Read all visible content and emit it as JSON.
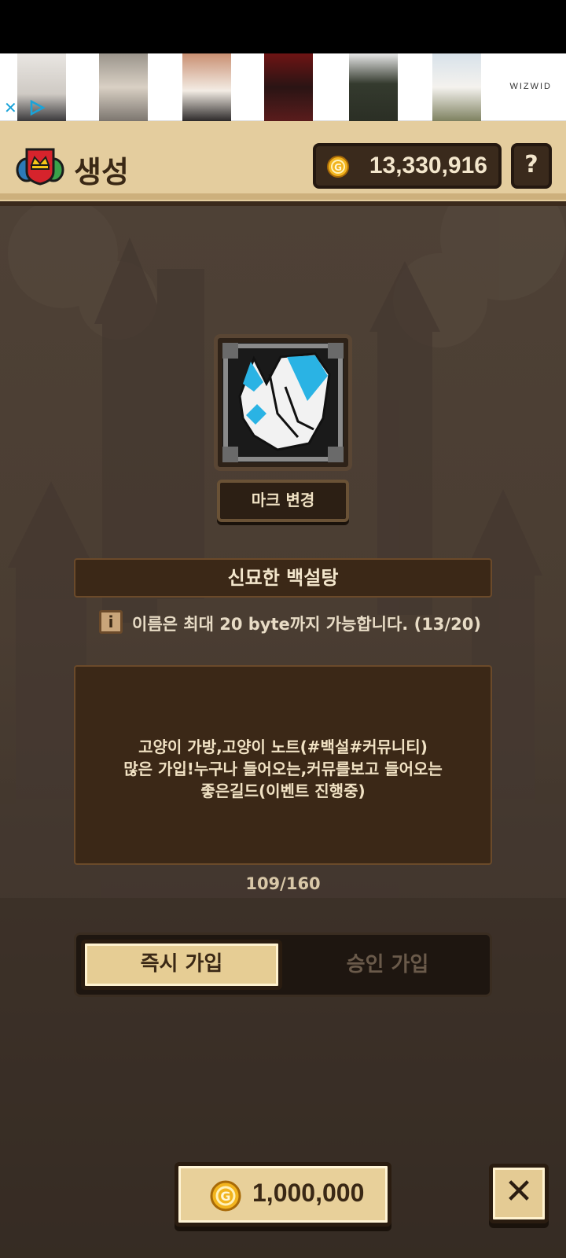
{
  "ad": {
    "brand": "WIZWID",
    "close_icon": "close-x-icon",
    "adchoices_icon": "play-triangle-icon"
  },
  "header": {
    "title": "생성",
    "gold": "13,330,916",
    "help_label": "?",
    "guild_icon": "guild-crest-icon"
  },
  "mark": {
    "change_label": "마크 변경"
  },
  "guild_name": {
    "value": "신묘한 백설탕",
    "info_text": "이름은 최대 20 byte까지 가능합니다. (13/20)",
    "info_icon_label": "i"
  },
  "description": {
    "lines": [
      "고양이 가방,고양이 노트(#백설#커뮤니티)",
      "많은 가입!누구나 들어오는,커뮤를보고 들어오는",
      "좋은길드(이벤트 진행중)"
    ],
    "counter": "109/160"
  },
  "join": {
    "instant_label": "즉시 가입",
    "approval_label": "승인 가입",
    "selected": "instant"
  },
  "footer": {
    "cost": "1,000,000",
    "close_label": "✕"
  },
  "colors": {
    "header_bg": "#e4cd9e",
    "panel_bg": "#3b2817",
    "accent_gold": "#e6cd94",
    "text_light": "#f3e6cc"
  }
}
